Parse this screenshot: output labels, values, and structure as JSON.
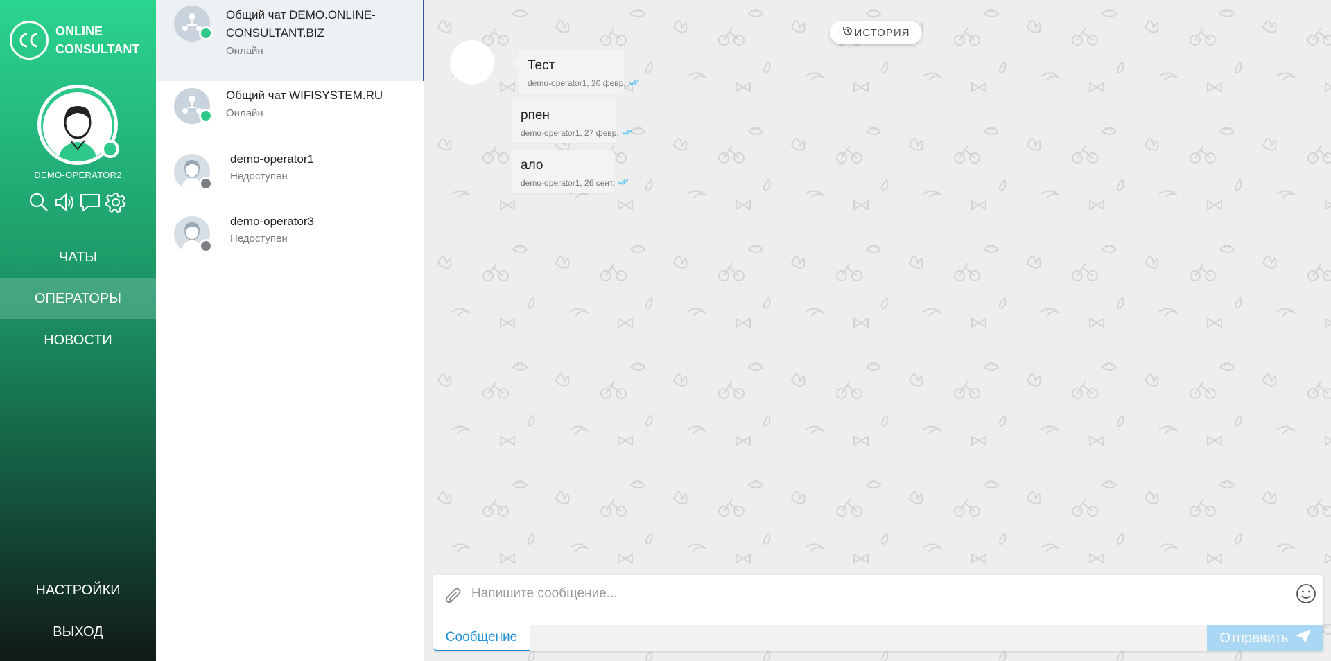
{
  "brand": {
    "line1": "ONLINE",
    "line2": "CONSULTANT"
  },
  "user": {
    "name": "DEMO-OPERATOR2"
  },
  "toolbar_icons": [
    "search-icon",
    "sound-icon",
    "chat-icon",
    "gear-icon"
  ],
  "nav": {
    "chats": "ЧАТЫ",
    "operators": "ОПЕРАТОРЫ",
    "news": "НОВОСТИ",
    "settings": "НАСТРОЙКИ",
    "logout": "ВЫХОД",
    "active": "operators"
  },
  "contacts": [
    {
      "name": "Общий чат DEMO.ONLINE-CONSULTANT.BIZ",
      "status": "Онлайн",
      "online": true,
      "type": "group"
    },
    {
      "name": "Общий чат WIFISYSTEM.RU",
      "status": "Онлайн",
      "online": true,
      "type": "group"
    },
    {
      "name": "demo-operator1",
      "status": "Недоступен",
      "online": false,
      "type": "person"
    },
    {
      "name": "demo-operator3",
      "status": "Недоступен",
      "online": false,
      "type": "person"
    }
  ],
  "chat": {
    "history_label": "ИСТОРИЯ",
    "messages": [
      {
        "text": "Тест",
        "meta": "demo-operator1, 20 февр."
      },
      {
        "text": "рпен",
        "meta": "demo-operator1, 27 февр."
      },
      {
        "text": "ало",
        "meta": "demo-operator1, 26 сент."
      }
    ]
  },
  "composer": {
    "placeholder": "Напишите сообщение...",
    "tab_label": "Сообщение",
    "send_label": "Отправить"
  },
  "colors": {
    "accent_green": "#2ec98a",
    "link_blue": "#1e90d6",
    "send_bg": "#a9d7f4",
    "offline": "#7d7f82",
    "read_check": "#4fc3f7"
  }
}
